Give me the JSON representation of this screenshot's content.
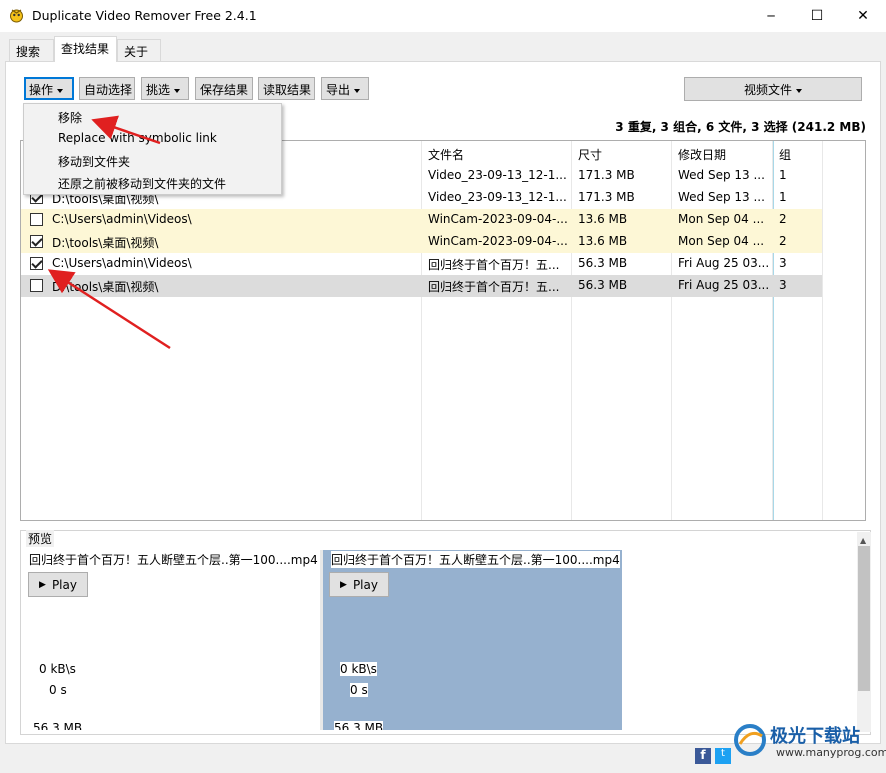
{
  "window": {
    "title": "Duplicate Video Remover Free 2.4.1",
    "minimize_glyph": "─",
    "maximize_glyph": "☐",
    "close_glyph": "✕"
  },
  "tabs": [
    {
      "label": "搜索"
    },
    {
      "label": "查找结果"
    },
    {
      "label": "关于"
    }
  ],
  "toolbar": {
    "operate": "操作",
    "auto_select": "自动选择",
    "filter": "挑选",
    "save_results": "保存结果",
    "load_results": "读取结果",
    "export": "导出",
    "video_files": "视频文件"
  },
  "menu": {
    "items": [
      "移除",
      "Replace with symbolic link",
      "移动到文件夹",
      "还原之前被移动到文件夹的文件"
    ]
  },
  "summary": "3 重复, 3 组合, 6 文件, 3 选择 (241.2 MB)",
  "table": {
    "columns": [
      "",
      "文件名",
      "尺寸",
      "修改日期",
      "组"
    ],
    "rows": [
      {
        "checked": false,
        "path": "",
        "name": "Video_23-09-13_12-1...",
        "size": "171.3 MB",
        "date": "Wed Sep 13 ...",
        "group": "1",
        "bg": "#ffffff"
      },
      {
        "checked": true,
        "path": "D:\\tools\\桌面\\视频\\",
        "name": "Video_23-09-13_12-1...",
        "size": "171.3 MB",
        "date": "Wed Sep 13 ...",
        "group": "1",
        "bg": "#ffffff"
      },
      {
        "checked": false,
        "path": "C:\\Users\\admin\\Videos\\",
        "name": "WinCam-2023-09-04-...",
        "size": "13.6 MB",
        "date": "Mon Sep 04 ...",
        "group": "2",
        "bg": "#fdf7d6"
      },
      {
        "checked": true,
        "path": "D:\\tools\\桌面\\视频\\",
        "name": "WinCam-2023-09-04-...",
        "size": "13.6 MB",
        "date": "Mon Sep 04 ...",
        "group": "2",
        "bg": "#fdf7d6"
      },
      {
        "checked": true,
        "path": "C:\\Users\\admin\\Videos\\",
        "name": "回归终于首个百万！五...",
        "size": "56.3 MB",
        "date": "Fri Aug 25 03...",
        "group": "3",
        "bg": "#ffffff"
      },
      {
        "checked": false,
        "path": "D:\\tools\\桌面\\视频\\",
        "name": "回归终于首个百万！五...",
        "size": "56.3 MB",
        "date": "Fri Aug 25 03...",
        "group": "3",
        "bg": "#dcdcdc"
      }
    ]
  },
  "preview": {
    "label": "预览",
    "left": {
      "filename": "回归终于首个百万！五人断壁五个层..第一100....mp4",
      "play": "Play",
      "rate": "0 kB\\s",
      "time": "0 s",
      "size": "56.3 MB"
    },
    "right": {
      "filename": "回归终于首个百万！五人断壁五个层..第一100....mp4",
      "play": "Play",
      "rate": "0 kB\\s",
      "time": "0 s",
      "size": "56.3 MB"
    }
  },
  "watermark": {
    "brand": "极光下载站",
    "url": "www.manyprog.com"
  },
  "colors": {
    "accent": "#0078d7",
    "selected_pane": "#96b1cf",
    "arrow": "#e02020",
    "group2_row": "#fdf7d6"
  }
}
